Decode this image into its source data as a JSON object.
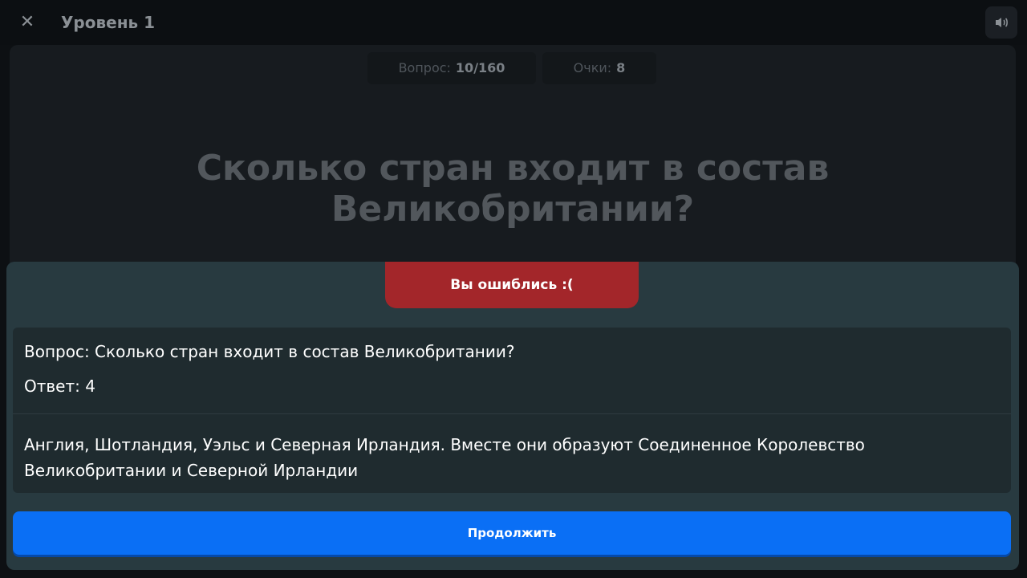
{
  "header": {
    "close_icon": "close-icon",
    "title": "Уровень 1",
    "sound_icon": "speaker-icon"
  },
  "stats": {
    "question_label": "Вопрос:",
    "question_value": "10/160",
    "score_label": "Очки:",
    "score_value": "8"
  },
  "question": {
    "text": "Сколько стран входит в состав Великобритании?"
  },
  "result": {
    "banner": "Вы ошиблись :(",
    "question_line": "Вопрос: Сколько стран входит в состав Великобритании?",
    "answer_line": "Ответ: 4",
    "explanation": "Англия, Шотландия, Уэльс и Северная Ирландия. Вместе они образуют Соединенное Королевство Великобритании и Северной Ирландии",
    "continue_label": "Продолжить"
  },
  "colors": {
    "banner_red": "#a3262a",
    "sheet_bg": "#283a40",
    "card_bg": "#1f2b2f",
    "button_blue": "#0a6ff5"
  }
}
